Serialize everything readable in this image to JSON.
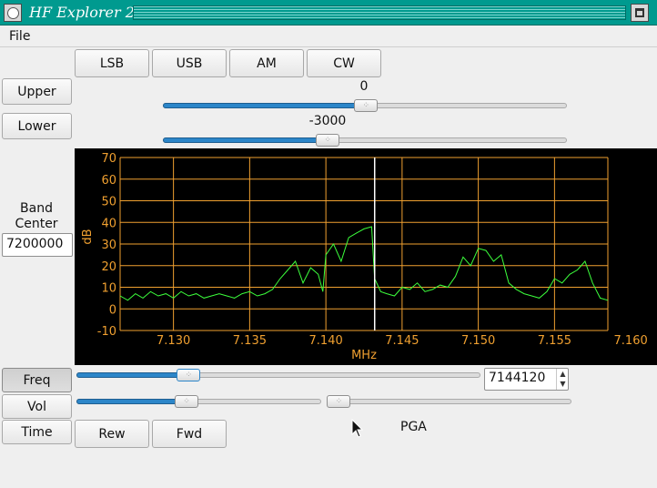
{
  "window": {
    "title": "HF Explorer 2"
  },
  "menu": {
    "file": "File"
  },
  "mode_buttons": {
    "lsb": "LSB",
    "usb": "USB",
    "am": "AM",
    "cw": "CW"
  },
  "filter": {
    "upper_label": "Upper",
    "upper_value": "0",
    "lower_label": "Lower",
    "lower_value": "-3000"
  },
  "band_center": {
    "label_line1": "Band",
    "label_line2": "Center",
    "value": "7200000"
  },
  "controls": {
    "freq_label": "Freq",
    "freq_value": "7144120",
    "vol_label": "Vol",
    "time_label": "Time",
    "rew": "Rew",
    "fwd": "Fwd",
    "pga_label": "PGA"
  },
  "slider_levels": {
    "upper": 0.503,
    "lower": 0.408,
    "freq": 0.278,
    "vol": 0.45,
    "pga": 0.05
  },
  "icons": {
    "app": "app-menu-icon",
    "maximize": "maximize-icon",
    "cursor": "mouse-cursor-icon"
  },
  "chart_data": {
    "type": "line",
    "xlabel": "MHz",
    "ylabel": "dB",
    "xlim": [
      7.1265,
      7.1585
    ],
    "ylim": [
      -10,
      70
    ],
    "xticks": [
      7.13,
      7.135,
      7.14,
      7.145,
      7.15,
      7.155,
      7.16
    ],
    "xtick_labels": [
      "7.130",
      "7.135",
      "7.140",
      "7.145",
      "7.150",
      "7.155",
      "7.160"
    ],
    "yticks": [
      -10,
      0,
      10,
      20,
      30,
      40,
      50,
      60,
      70
    ],
    "ytick_labels": [
      "-10",
      "0",
      "10",
      "20",
      "30",
      "40",
      "50",
      "60",
      "70"
    ],
    "grid": true,
    "marker_x": 7.1432,
    "colors": {
      "grid": "#f0a030",
      "axis_text": "#f0a030",
      "trace": "#3cff3c",
      "marker": "#ffffff",
      "background": "#000000"
    },
    "series": [
      {
        "x": [
          7.1265,
          7.127,
          7.1275,
          7.128,
          7.1285,
          7.129,
          7.1295,
          7.13,
          7.1305,
          7.131,
          7.1315,
          7.132,
          7.1325,
          7.133,
          7.1335,
          7.134,
          7.1345,
          7.135,
          7.1355,
          7.136,
          7.1365,
          7.137,
          7.1375,
          7.138,
          7.1385,
          7.139,
          7.1395,
          7.1398,
          7.14,
          7.1405,
          7.141,
          7.1415,
          7.142,
          7.1425,
          7.143,
          7.1432,
          7.1436,
          7.144,
          7.1445,
          7.145,
          7.1455,
          7.146,
          7.1465,
          7.147,
          7.1475,
          7.148,
          7.1485,
          7.149,
          7.1495,
          7.15,
          7.1505,
          7.151,
          7.1515,
          7.152,
          7.1525,
          7.153,
          7.1535,
          7.154,
          7.1545,
          7.155,
          7.1555,
          7.156,
          7.1565,
          7.157,
          7.1575,
          7.158,
          7.1585
        ],
        "y": [
          6,
          4,
          7,
          5,
          8,
          6,
          7,
          5,
          8,
          6,
          7,
          5,
          6,
          7,
          6,
          5,
          7,
          8,
          6,
          7,
          9,
          14,
          18,
          22,
          12,
          19,
          16,
          8,
          25,
          30,
          22,
          33,
          35,
          37,
          38,
          14,
          8,
          7,
          6,
          10,
          9,
          12,
          8,
          9,
          11,
          10,
          15,
          24,
          20,
          28,
          27,
          22,
          25,
          12,
          9,
          7,
          6,
          5,
          8,
          14,
          12,
          16,
          18,
          22,
          12,
          5,
          4
        ]
      }
    ]
  }
}
